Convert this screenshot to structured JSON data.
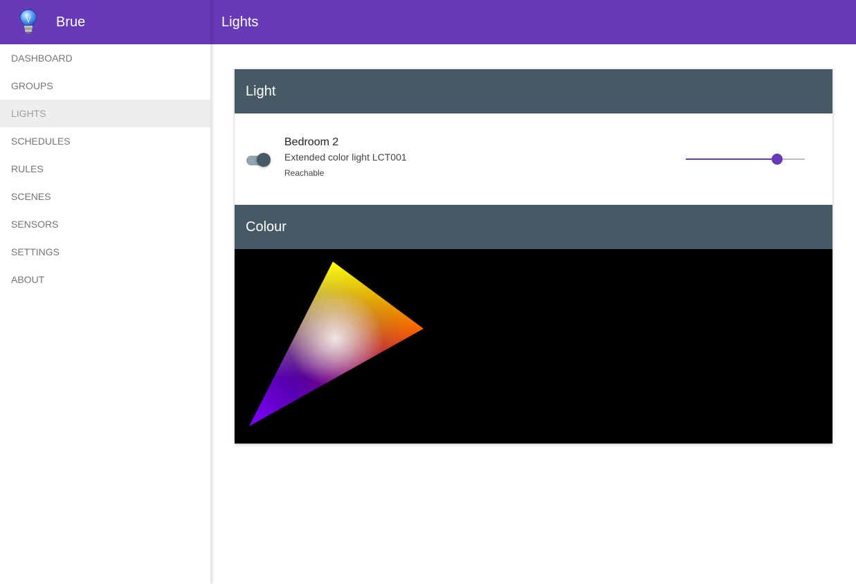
{
  "app": {
    "name": "Brue",
    "logo_icon": "lightbulb-icon",
    "accent_color": "#673ab7",
    "header_color": "#455a64"
  },
  "topbar": {
    "title": "Lights"
  },
  "sidebar": {
    "items": [
      {
        "label": "DASHBOARD",
        "active": false
      },
      {
        "label": "GROUPS",
        "active": false
      },
      {
        "label": "LIGHTS",
        "active": true
      },
      {
        "label": "SCHEDULES",
        "active": false
      },
      {
        "label": "RULES",
        "active": false
      },
      {
        "label": "SCENES",
        "active": false
      },
      {
        "label": "SENSORS",
        "active": false
      },
      {
        "label": "SETTINGS",
        "active": false
      },
      {
        "label": "ABOUT",
        "active": false
      }
    ]
  },
  "light_section": {
    "title": "Light",
    "light": {
      "name": "Bedroom 2",
      "type": "Extended color light LCT001",
      "status": "Reachable",
      "on": true,
      "brightness": 0.77
    }
  },
  "colour_section": {
    "title": "Colour",
    "gamut_colors": {
      "red": "#ff0000",
      "green": "#ffff00",
      "blue": "#7f00ff",
      "white": "#ffffff"
    }
  }
}
